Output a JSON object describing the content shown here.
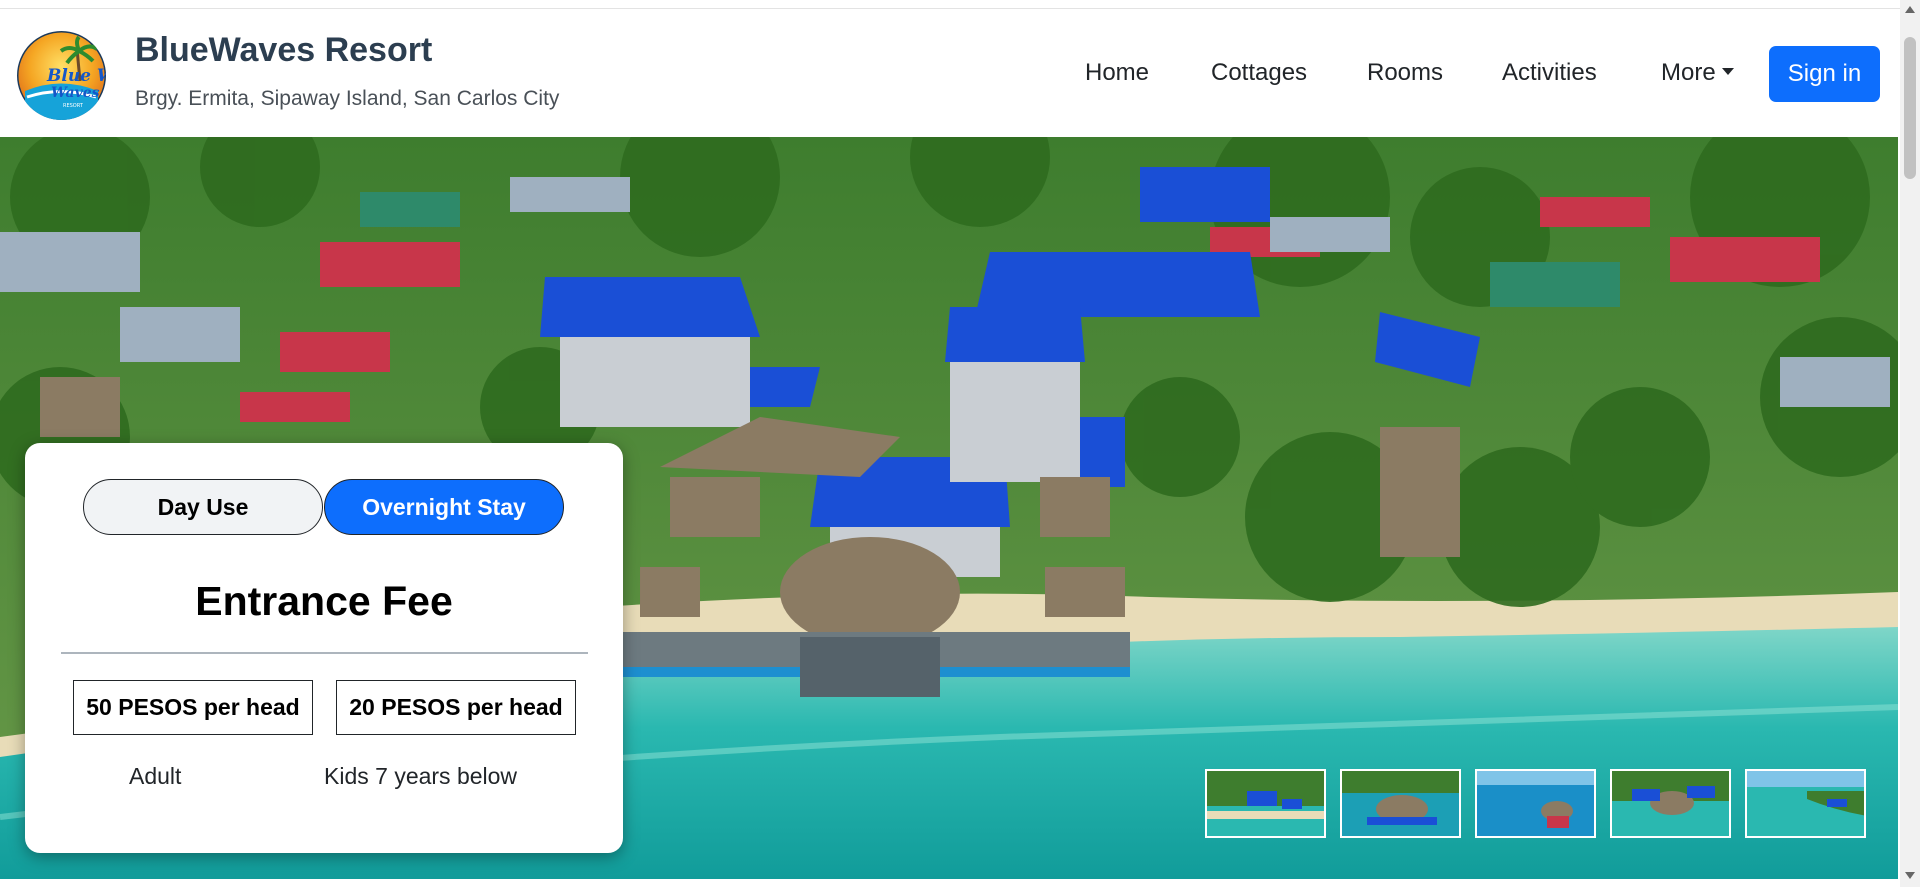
{
  "header": {
    "title": "BlueWaves Resort",
    "subtitle": "Brgy. Ermita, Sipaway Island, San Carlos City",
    "logo_text": "Blue Waves",
    "logo_subtext": "RESORT"
  },
  "nav": {
    "items": [
      {
        "label": "Home"
      },
      {
        "label": "Cottages"
      },
      {
        "label": "Rooms"
      },
      {
        "label": "Activities"
      },
      {
        "label": "More"
      }
    ],
    "signin_label": "Sign in"
  },
  "booking": {
    "tabs": [
      {
        "label": "Day Use",
        "active": false
      },
      {
        "label": "Overnight Stay",
        "active": true
      }
    ],
    "heading": "Entrance Fee",
    "prices": [
      {
        "amount": "50 PESOS per head",
        "label": "Adult"
      },
      {
        "amount": "20 PESOS per head",
        "label": "Kids 7 years below"
      }
    ]
  },
  "gallery": {
    "thumbnail_count": 5
  },
  "colors": {
    "accent": "#0d6efd",
    "title": "#2c3e50",
    "water": "#2ab8b0",
    "roof_blue": "#1a4fd6"
  }
}
